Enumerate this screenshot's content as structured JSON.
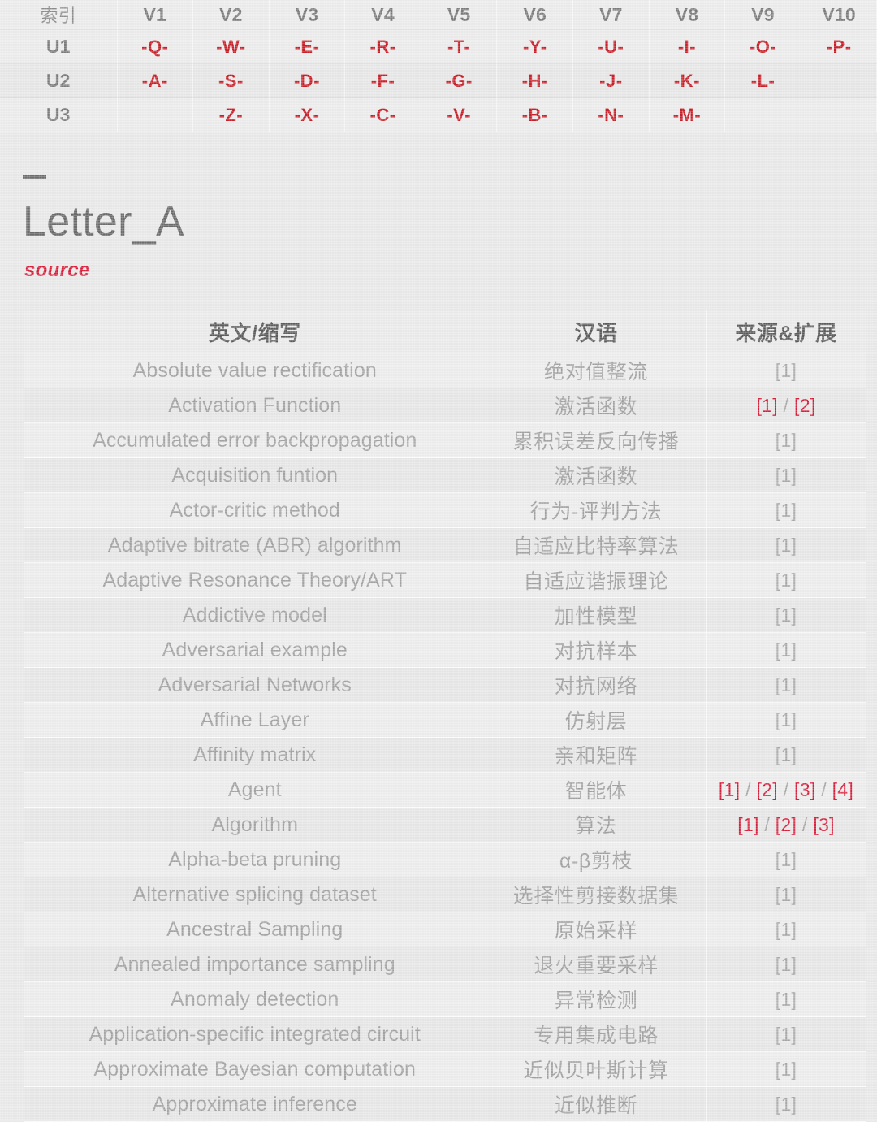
{
  "index_table": {
    "corner_label": "索引",
    "columns": [
      "V1",
      "V2",
      "V3",
      "V4",
      "V5",
      "V6",
      "V7",
      "V8",
      "V9",
      "V10"
    ],
    "rows": [
      {
        "label": "U1",
        "cells": [
          "-Q-",
          "-W-",
          "-E-",
          "-R-",
          "-T-",
          "-Y-",
          "-U-",
          "-I-",
          "-O-",
          "-P-"
        ]
      },
      {
        "label": "U2",
        "cells": [
          "-A-",
          "-S-",
          "-D-",
          "-F-",
          "-G-",
          "-H-",
          "-J-",
          "-K-",
          "-L-",
          ""
        ]
      },
      {
        "label": "U3",
        "cells": [
          "",
          "-Z-",
          "-X-",
          "-C-",
          "-V-",
          "-B-",
          "-N-",
          "-M-",
          "",
          ""
        ]
      }
    ]
  },
  "header": {
    "title": "Letter_A",
    "source_label": "source"
  },
  "colors": {
    "page_background": "#e9e9e9",
    "index_letter_red": "#c9222b",
    "accent_red": "#d8203c",
    "heading_gray": "#5e5e5e",
    "body_gray": "#a4a4a4",
    "title_gray": "#6d6d6d"
  },
  "glossary": {
    "columns": [
      "英文/缩写",
      "汉语",
      "来源&扩展"
    ],
    "rows": [
      {
        "en": "Absolute value rectification",
        "zh": "绝对值整流",
        "src": [
          "1"
        ]
      },
      {
        "en": "Activation Function",
        "zh": "激活函数",
        "src": [
          "1",
          "2"
        ]
      },
      {
        "en": "Accumulated error backpropagation",
        "zh": "累积误差反向传播",
        "src": [
          "1"
        ]
      },
      {
        "en": "Acquisition funtion",
        "zh": "激活函数",
        "src": [
          "1"
        ]
      },
      {
        "en": "Actor-critic method",
        "zh": "行为-评判方法",
        "src": [
          "1"
        ]
      },
      {
        "en": "Adaptive bitrate (ABR) algorithm",
        "zh": "自适应比特率算法",
        "src": [
          "1"
        ]
      },
      {
        "en": "Adaptive Resonance Theory/ART",
        "zh": "自适应谐振理论",
        "src": [
          "1"
        ]
      },
      {
        "en": "Addictive model",
        "zh": "加性模型",
        "src": [
          "1"
        ]
      },
      {
        "en": "Adversarial example",
        "zh": "对抗样本",
        "src": [
          "1"
        ]
      },
      {
        "en": "Adversarial Networks",
        "zh": "对抗网络",
        "src": [
          "1"
        ]
      },
      {
        "en": "Affine Layer",
        "zh": "仿射层",
        "src": [
          "1"
        ]
      },
      {
        "en": "Affinity matrix",
        "zh": "亲和矩阵",
        "src": [
          "1"
        ]
      },
      {
        "en": "Agent",
        "zh": "智能体",
        "src": [
          "1",
          "2",
          "3",
          "4"
        ]
      },
      {
        "en": "Algorithm",
        "zh": "算法",
        "src": [
          "1",
          "2",
          "3"
        ]
      },
      {
        "en": "Alpha-beta pruning",
        "zh": "α-β剪枝",
        "src": [
          "1"
        ]
      },
      {
        "en": "Alternative splicing dataset",
        "zh": "选择性剪接数据集",
        "src": [
          "1"
        ]
      },
      {
        "en": "Ancestral Sampling",
        "zh": "原始采样",
        "src": [
          "1"
        ]
      },
      {
        "en": "Annealed importance sampling",
        "zh": "退火重要采样",
        "src": [
          "1"
        ]
      },
      {
        "en": "Anomaly detection",
        "zh": "异常检测",
        "src": [
          "1"
        ]
      },
      {
        "en": "Application-specific integrated circuit",
        "zh": "专用集成电路",
        "src": [
          "1"
        ]
      },
      {
        "en": "Approximate Bayesian computation",
        "zh": "近似贝叶斯计算",
        "src": [
          "1"
        ]
      },
      {
        "en": "Approximate inference",
        "zh": "近似推断",
        "src": [
          "1"
        ]
      }
    ]
  }
}
